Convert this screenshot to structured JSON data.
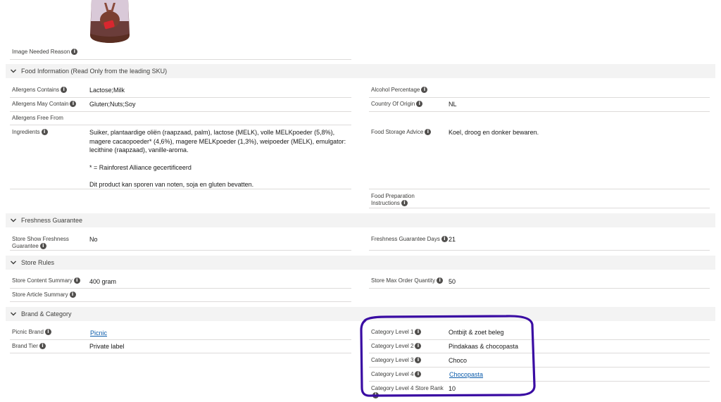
{
  "image_needed_reason": {
    "label": "Image Needed Reason"
  },
  "sections": {
    "food": "Food Information (Read Only from the leading SKU)",
    "freshness": "Freshness Guarantee",
    "store_rules": "Store Rules",
    "brand": "Brand & Category"
  },
  "food": {
    "allergens_contains": {
      "label": "Allergens Contains",
      "value": "Lactose;Milk"
    },
    "allergens_may_contain": {
      "label": "Allergens May Contain",
      "value": "Gluten;Nuts;Soy"
    },
    "allergens_free_from": {
      "label": "Allergens Free From"
    },
    "ingredients": {
      "label": "Ingredients",
      "line1": "Suiker, plantaardige oliën (raapzaad, palm), lactose (MELK), volle MELKpoeder (5,8%),",
      "line2": "magere cacaopoeder* (4,6%), magere MELKpoeder (1,3%), weipoeder (MELK), emulgator:",
      "line3": "lecithine (raapzaad), vanille-aroma.",
      "line4": "* = Rainforest Alliance gecertificeerd",
      "line5": "Dit product kan sporen van noten, soja en gluten bevatten."
    },
    "alcohol_percentage": {
      "label": "Alcohol Percentage"
    },
    "country_of_origin": {
      "label": "Country Of Origin",
      "value": "NL"
    },
    "food_storage_advice": {
      "label": "Food Storage Advice",
      "value": "Koel, droog en donker bewaren."
    },
    "food_preparation": {
      "label_line1": "Food Preparation",
      "label_line2": "Instructions"
    }
  },
  "freshness": {
    "store_show": {
      "label_line1": "Store Show Freshness",
      "label_line2": "Guarantee",
      "value": "No"
    },
    "days": {
      "label": "Freshness Guarantee Days",
      "value": "21"
    }
  },
  "store_rules": {
    "content_summary": {
      "label": "Store Content Summary",
      "value": "400 gram"
    },
    "article_summary": {
      "label": "Store Article Summary"
    },
    "max_order": {
      "label": "Store Max Order Quantity",
      "value": "50"
    }
  },
  "brand": {
    "picnic_brand": {
      "label": "Picnic Brand",
      "value": "Picnic"
    },
    "brand_tier": {
      "label": "Brand Tier",
      "value": "Private label"
    },
    "cat1": {
      "label": "Category Level 1",
      "value": "Ontbijt & zoet beleg"
    },
    "cat2": {
      "label": "Category Level 2",
      "value": "Pindakaas & chocopasta"
    },
    "cat3": {
      "label": "Category Level 3",
      "value": "Choco"
    },
    "cat4": {
      "label": "Category Level 4",
      "value": "Chocopasta"
    },
    "cat4_rank": {
      "label": "Category Level 4 Store Rank",
      "value": "10"
    }
  },
  "icons": {
    "info": "info-icon",
    "chevron": "chevron-down-icon"
  },
  "colors": {
    "link": "#0b5cab",
    "highlight": "#3a0ca3",
    "section_bg": "#f3f3f3"
  }
}
